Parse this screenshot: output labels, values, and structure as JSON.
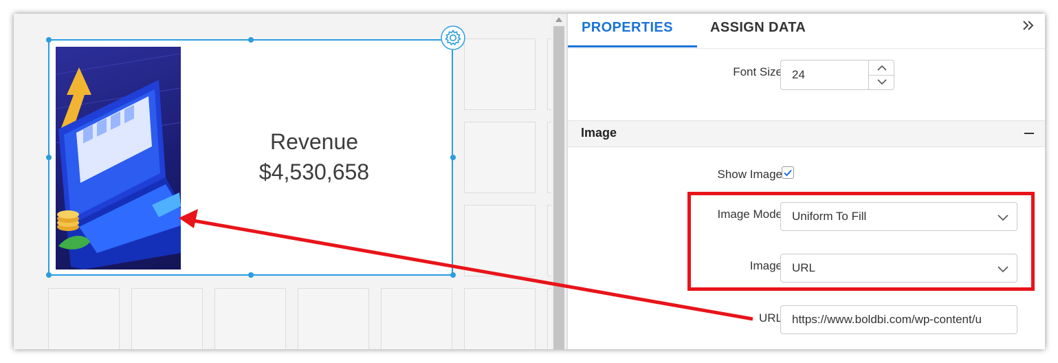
{
  "widget": {
    "title": "Revenue",
    "value": "$4,530,658"
  },
  "panel": {
    "tabs": {
      "properties": "PROPERTIES",
      "assign_data": "ASSIGN DATA"
    },
    "font_size": {
      "label": "Font Size",
      "value": "24"
    },
    "image_section": {
      "title": "Image",
      "show_image": {
        "label": "Show Image",
        "checked": true
      },
      "image_mode": {
        "label": "Image Mode",
        "value": "Uniform To Fill"
      },
      "image": {
        "label": "Image",
        "value": "URL"
      },
      "url": {
        "label": "URL",
        "value": "https://www.boldbi.com/wp-content/u"
      }
    }
  },
  "colors": {
    "accent": "#1a73d9",
    "selection": "#2b9ce0",
    "highlight": "#e8141a"
  },
  "icons": [
    "gear-icon",
    "chevron-double-right-icon",
    "chevron-down-icon",
    "chevron-up-icon",
    "check-icon",
    "minus-icon"
  ]
}
